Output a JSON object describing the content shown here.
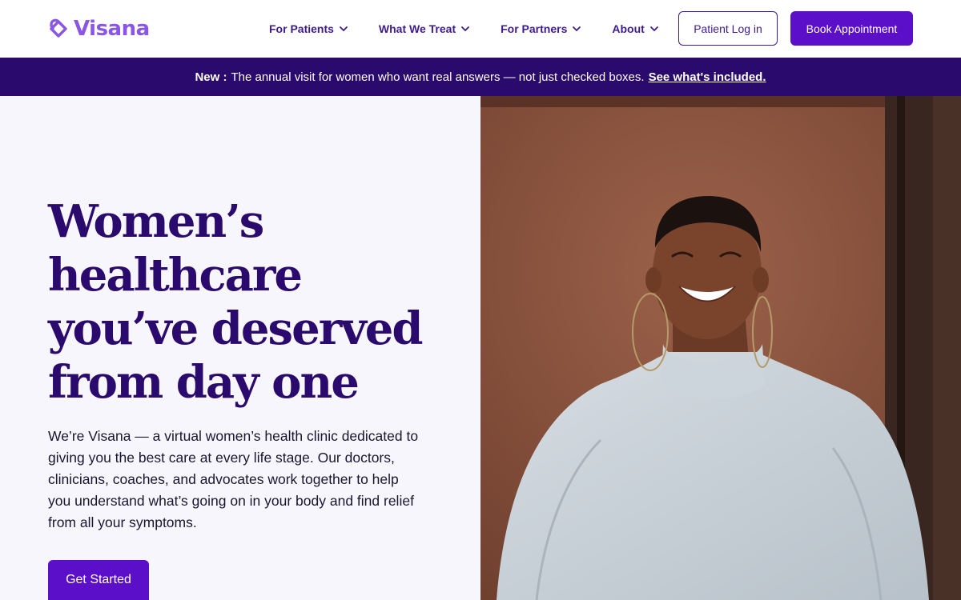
{
  "brand": {
    "name": "Visana",
    "logo_icon": "heart-diamond-icon",
    "accent": "#8a56e8",
    "primary": "#5b0fc9",
    "dark": "#2b0a6e"
  },
  "nav": {
    "items": [
      {
        "label": "For Patients",
        "icon": "chevron-down-icon"
      },
      {
        "label": "What We Treat",
        "icon": "chevron-down-icon"
      },
      {
        "label": "For Partners",
        "icon": "chevron-down-icon"
      },
      {
        "label": "About",
        "icon": "chevron-down-icon"
      }
    ],
    "login_label": "Patient Log in",
    "book_label": "Book Appointment"
  },
  "banner": {
    "new_label": "New :",
    "message": "The annual visit for women who want real answers — not just checked boxes.",
    "link_label": "See what's included."
  },
  "hero": {
    "title": "Women’s healthcare you’ve deserved from day one",
    "body": "We’re Visana — a virtual women’s health clinic dedicated to giving you the best care at every life stage. Our doctors, clinicians, coaches, and advocates work together to help you understand what’s going on in your body and find relief from all your symptoms.",
    "cta_label": "Get Started",
    "image_subject": "smiling woman in white turtleneck"
  }
}
